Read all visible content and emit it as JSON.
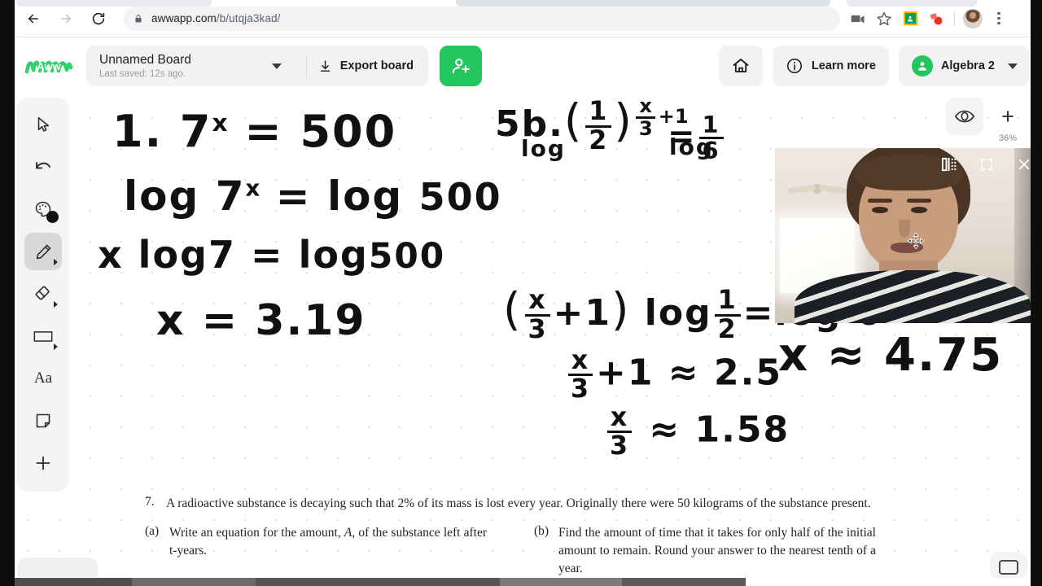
{
  "browser": {
    "back_label": "Back",
    "forward_label": "Forward",
    "reload_label": "Reload",
    "url_scheme_host": "awwapp.com",
    "url_path": "/b/utqja3kad/",
    "lock_icon": "lock-icon",
    "icons": {
      "video": "video-camera-icon",
      "bookmark": "star-icon",
      "extension_contacts": "contacts-extension-icon",
      "extension_red": "red-extension-icon",
      "profile": "profile-avatar",
      "menu": "three-dot-menu-icon"
    }
  },
  "app_header": {
    "logo_text": "Aww",
    "board_title": "Unnamed Board",
    "board_saved": "Last saved: 12s ago.",
    "board_caret_icon": "chevron-down-icon",
    "export_icon": "download-icon",
    "export_label": "Export board",
    "invite_icon": "add-user-icon",
    "home_icon": "home-icon",
    "info_icon": "info-circle-icon",
    "learn_more_label": "Learn more",
    "account_icon": "user-avatar-icon",
    "account_name": "Algebra 2",
    "account_caret_icon": "chevron-down-icon",
    "accent_green": "#22c55e"
  },
  "toolbar": {
    "items": [
      {
        "name": "select-tool",
        "icon": "cursor-arrow-icon",
        "active": false,
        "has_submenu": false
      },
      {
        "name": "undo-tool",
        "icon": "undo-arrow-icon",
        "active": false,
        "has_submenu": false
      },
      {
        "name": "color-tool",
        "icon": "palette-icon",
        "active": false,
        "has_submenu": false,
        "swatch_color": "#111111"
      },
      {
        "name": "pencil-tool",
        "icon": "pencil-icon",
        "active": true,
        "has_submenu": true
      },
      {
        "name": "eraser-tool",
        "icon": "eraser-icon",
        "active": false,
        "has_submenu": true
      },
      {
        "name": "shape-tool",
        "icon": "rectangle-icon",
        "active": false,
        "has_submenu": true
      },
      {
        "name": "text-tool",
        "icon": "text-aa-icon",
        "active": false,
        "has_submenu": false,
        "label": "Aa"
      },
      {
        "name": "note-tool",
        "icon": "sticky-note-icon",
        "active": false,
        "has_submenu": false
      },
      {
        "name": "add-tool",
        "icon": "plus-icon",
        "active": false,
        "has_submenu": false
      }
    ]
  },
  "canvas_controls": {
    "visibility_icon": "eye-icon",
    "zoom_in_icon": "plus-icon",
    "zoom_level": "36%"
  },
  "ink_notes": {
    "left": [
      {
        "id": "l1",
        "text": "1. 7ˣ = 500"
      },
      {
        "id": "l2",
        "text": "log 7ˣ = log 500"
      },
      {
        "id": "l3",
        "text": "x log 7 = log 500"
      },
      {
        "id": "l4",
        "text": "x = 3.19"
      }
    ],
    "right": [
      {
        "id": "r1",
        "text": "5b.  (1/2)^(x/3 + 1) = 1/6"
      },
      {
        "id": "r1_sub_left",
        "text": "log"
      },
      {
        "id": "r1_sub_right",
        "text": "log"
      },
      {
        "id": "r2",
        "text": "(x/3 + 1) log 1/2 = log 6"
      },
      {
        "id": "r3",
        "text": "x/3 + 1 ≈ 2.5"
      },
      {
        "id": "r4",
        "text": "x/3 ≈ 1.58"
      },
      {
        "id": "r5",
        "text": "x ≈ 4.75"
      }
    ]
  },
  "worksheet": {
    "number": "7.",
    "prompt": "A radioactive substance is decaying such that 2% of its mass is lost every year.  Originally there were 50 kilograms of the substance present.",
    "parts": [
      {
        "letter": "(a)",
        "text_before": "Write an equation for the amount, ",
        "italic": "A",
        "text_after": ", of the substance left after t-years."
      },
      {
        "letter": "(b)",
        "text_before": "Find the amount of time that it takes for only half of the initial amount to remain.  Round your answer to the nearest tenth of a year.",
        "italic": "",
        "text_after": ""
      }
    ]
  },
  "video_overlay": {
    "pin_icon": "pin-layout-icon",
    "fullscreen_icon": "fullscreen-expand-icon",
    "close_icon": "close-x-icon",
    "cursor_icon": "move-cursor-icon"
  },
  "bottom": {
    "pill_name": "canvas-tab-stub",
    "right_button_icon": "frame-icon"
  }
}
